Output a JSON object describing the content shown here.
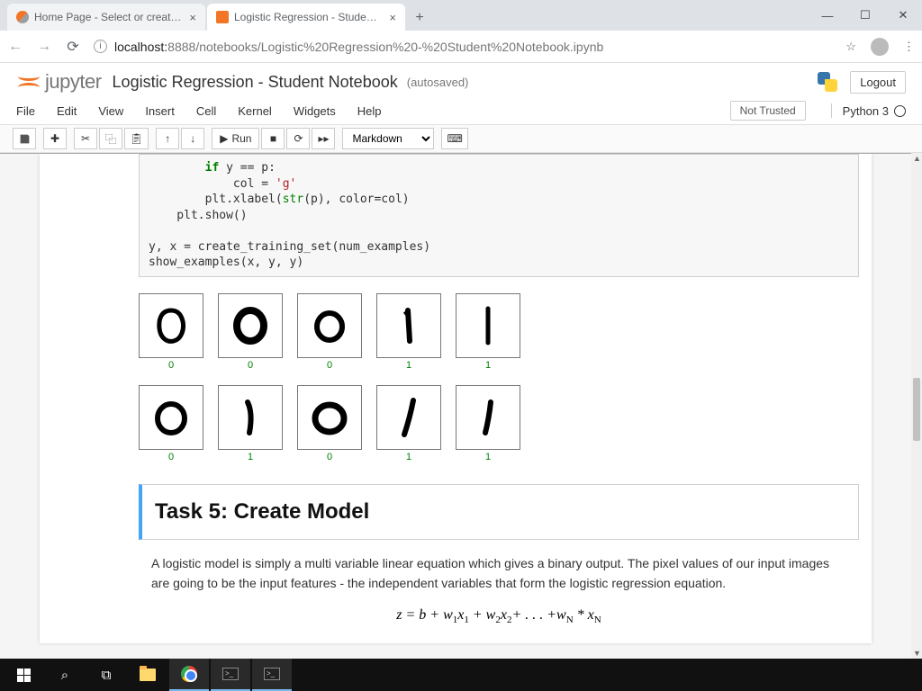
{
  "browser": {
    "tabs": [
      {
        "title": "Home Page - Select or create a n"
      },
      {
        "title": "Logistic Regression - Student No"
      }
    ],
    "url_host": "localhost:",
    "url_port": "8888",
    "url_path": "/notebooks/Logistic%20Regression%20-%20Student%20Notebook.ipynb"
  },
  "jupyter": {
    "brand": "jupyter",
    "title": "Logistic Regression - Student Notebook",
    "autosave": "(autosaved)",
    "logout": "Logout",
    "menus": [
      "File",
      "Edit",
      "View",
      "Insert",
      "Cell",
      "Kernel",
      "Widgets",
      "Help"
    ],
    "trusted": "Not Trusted",
    "kernel": "Python 3",
    "run_label": "Run",
    "celltype": "Markdown"
  },
  "code": {
    "l1_a": "        if",
    "l1_b": " y == p:",
    "l2": "            col = ",
    "l2_s": "'g'",
    "l3_a": "        plt.xlabel(",
    "l3_bi": "str",
    "l3_b": "(p), color=col)",
    "l4": "    plt.show()",
    "l5": "",
    "l6": "y, x = create_training_set(num_examples)",
    "l7": "show_examples(x, y, y)"
  },
  "digits": {
    "row1_labels": [
      "0",
      "0",
      "0",
      "1",
      "1"
    ],
    "row2_labels": [
      "0",
      "1",
      "0",
      "1",
      "1"
    ]
  },
  "task": {
    "heading": "Task 5: Create Model",
    "text": "A logistic model is simply a multi variable linear equation which gives a binary output. The pixel values of our input images are going to be the input features - the independent variables that form the logistic regression equation.",
    "equation_plain": "z = b + w1x1 + w2x2 + ... + wN * xN"
  }
}
